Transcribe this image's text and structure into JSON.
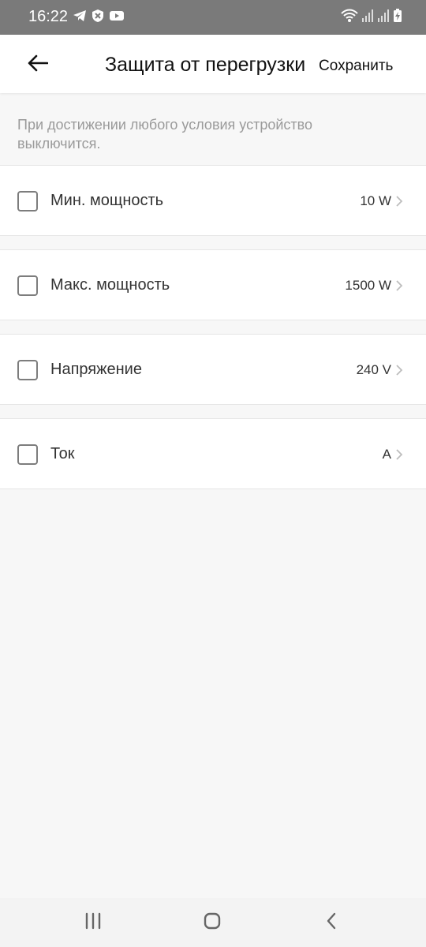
{
  "status_bar": {
    "time": "16:22",
    "left_icons": [
      "telegram-icon",
      "vpn-shield-icon",
      "youtube-icon"
    ],
    "right_icons": [
      "wifi-icon",
      "signal-icon",
      "signal-icon",
      "battery-charging-icon"
    ]
  },
  "header": {
    "title": "Защита от перегрузки",
    "save_label": "Сохранить"
  },
  "hint": "При достижении любого условия устройство выключится.",
  "items": [
    {
      "label": "Мин. мощность",
      "value": "10 W",
      "checked": false
    },
    {
      "label": "Макс. мощность",
      "value": "1500 W",
      "checked": false
    },
    {
      "label": "Напряжение",
      "value": "240 V",
      "checked": false
    },
    {
      "label": "Ток",
      "value": "A",
      "checked": false
    }
  ],
  "colors": {
    "status_bar": "#7a7a7a",
    "background": "#f7f7f7",
    "card": "#ffffff",
    "hint_text": "#9a9a9a",
    "checkbox_border": "#7d7d7d"
  }
}
